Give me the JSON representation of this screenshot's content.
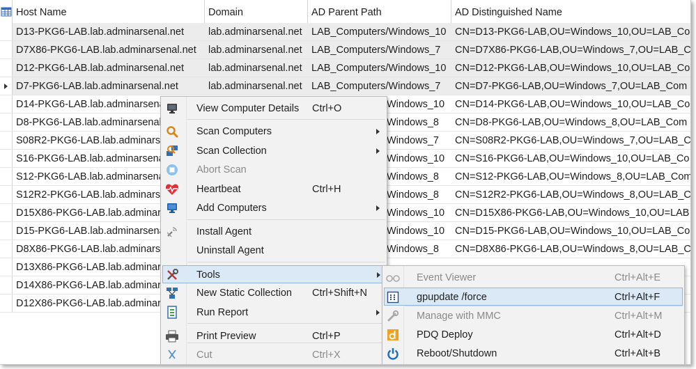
{
  "grid": {
    "columns": [
      "Host Name",
      "Domain",
      "AD Parent Path",
      "AD Distinguished Name"
    ],
    "rows": [
      [
        "D13-PKG6-LAB.lab.adminarsenal.net",
        "lab.adminarsenal.net",
        "LAB_Computers/Windows_10",
        "CN=D13-PKG6-LAB,OU=Windows_10,OU=LAB_Co"
      ],
      [
        "D7X86-PKG6-LAB.lab.adminarsenal.net",
        "lab.adminarsenal.net",
        "LAB_Computers/Windows_7",
        "CN=D7X86-PKG6-LAB,OU=Windows_7,OU=LAB_C"
      ],
      [
        "D12-PKG6-LAB.lab.adminarsenal.net",
        "lab.adminarsenal.net",
        "LAB_Computers/Windows_10",
        "CN=D12-PKG6-LAB,OU=Windows_10,OU=LAB_Co"
      ],
      [
        "D7-PKG6-LAB.lab.adminarsenal.net",
        "lab.adminarsenal.net",
        "LAB_Computers/Windows_7",
        "CN=D7-PKG6-LAB,OU=Windows_7,OU=LAB_Com"
      ],
      [
        "D14-PKG6-LAB.lab.adminarsenal",
        "",
        "Windows_10",
        "CN=D14-PKG6-LAB,OU=Windows_10,OU=LAB_Co"
      ],
      [
        "D8-PKG6-LAB.lab.adminarsenal",
        "",
        "Windows_8",
        "CN=D8-PKG6-LAB,OU=Windows_8,OU=LAB_Com"
      ],
      [
        "S08R2-PKG6-LAB.lab.adminarse",
        "",
        "Windows_7",
        "CN=S08R2-PKG6-LAB,OU=Windows_7,OU=LAB_C"
      ],
      [
        "S16-PKG6-LAB.lab.adminarsena",
        "",
        "Windows_10",
        "CN=S16-PKG6-LAB,OU=Windows_10,OU=LAB_Co"
      ],
      [
        "S12-PKG6-LAB.lab.adminarsena",
        "",
        "Windows_8",
        "CN=S12-PKG6-LAB,OU=Windows_8,OU=LAB_Com"
      ],
      [
        "S12R2-PKG6-LAB.lab.adminarse",
        "",
        "Windows_8",
        "CN=S12R2-PKG6-LAB,OU=Windows_8,OU=LAB_C"
      ],
      [
        "D15X86-PKG6-LAB.lab.adminars",
        "",
        "Windows_10",
        "CN=D15X86-PKG6-LAB,OU=Windows_10,OU=LAB"
      ],
      [
        "D15-PKG6-LAB.lab.adminarsena",
        "",
        "Windows_10",
        "CN=D15-PKG6-LAB,OU=Windows_10,OU=LAB_Co"
      ],
      [
        "D8X86-PKG6-LAB.lab.adminars",
        "",
        "Windows_8",
        "CN=D8X86-PKG6-LAB,OU=Windows_8,OU=LAB_C"
      ],
      [
        "D13X86-PKG6-LAB.lab.adminar",
        "",
        "",
        ""
      ],
      [
        "D14X86-PKG6-LAB.lab.adminar",
        "",
        "",
        ""
      ],
      [
        "D12X86-PKG6-LAB.lab.adminar",
        "",
        "",
        ""
      ]
    ],
    "current_row": 3
  },
  "context_menu": {
    "items": [
      {
        "label": "View Computer Details",
        "shortcut": "Ctrl+O",
        "icon": "monitor-icon",
        "submenu": false,
        "disabled": false
      },
      {
        "label": "Scan Computers",
        "shortcut": "",
        "icon": "magnifier-icon",
        "submenu": true,
        "disabled": false
      },
      {
        "label": "Scan Collection",
        "shortcut": "",
        "icon": "scan-collection-icon",
        "submenu": true,
        "disabled": false
      },
      {
        "label": "Abort Scan",
        "shortcut": "",
        "icon": "stop-icon",
        "submenu": false,
        "disabled": true
      },
      {
        "label": "Heartbeat",
        "shortcut": "Ctrl+H",
        "icon": "heart-icon",
        "submenu": false,
        "disabled": false
      },
      {
        "label": "Add Computers",
        "shortcut": "",
        "icon": "add-monitor-icon",
        "submenu": true,
        "disabled": false
      },
      {
        "label": "Install Agent",
        "shortcut": "",
        "icon": "satellite-icon",
        "submenu": false,
        "disabled": false
      },
      {
        "label": "Uninstall Agent",
        "shortcut": "",
        "icon": "",
        "submenu": false,
        "disabled": false
      },
      {
        "label": "Tools",
        "shortcut": "",
        "icon": "tools-icon",
        "submenu": true,
        "disabled": false
      },
      {
        "label": "New Static Collection",
        "shortcut": "Ctrl+Shift+N",
        "icon": "network-icon",
        "submenu": false,
        "disabled": false
      },
      {
        "label": "Run Report",
        "shortcut": "",
        "icon": "report-icon",
        "submenu": true,
        "disabled": false
      },
      {
        "label": "Print Preview",
        "shortcut": "Ctrl+P",
        "icon": "printer-icon",
        "submenu": false,
        "disabled": false
      },
      {
        "label": "Cut",
        "shortcut": "Ctrl+X",
        "icon": "scissors-icon",
        "submenu": false,
        "disabled": true
      }
    ]
  },
  "tools_submenu": {
    "items": [
      {
        "label": "Event Viewer",
        "shortcut": "Ctrl+Alt+E",
        "icon": "glasses-icon",
        "disabled": true
      },
      {
        "label": "gpupdate /force",
        "shortcut": "Ctrl+Alt+F",
        "icon": "gpupdate-icon",
        "disabled": false
      },
      {
        "label": "Manage with MMC",
        "shortcut": "Ctrl+Alt+M",
        "icon": "wrench-icon",
        "disabled": true
      },
      {
        "label": "PDQ Deploy",
        "shortcut": "Ctrl+Alt+D",
        "icon": "pdq-deploy-icon",
        "disabled": false
      },
      {
        "label": "Reboot/Shutdown",
        "shortcut": "Ctrl+Alt+B",
        "icon": "power-icon",
        "disabled": false
      }
    ]
  },
  "colors": {
    "highlight": "#dbe9f7",
    "highlight_border": "#8fb7e0",
    "row_alt": "#ececec"
  }
}
